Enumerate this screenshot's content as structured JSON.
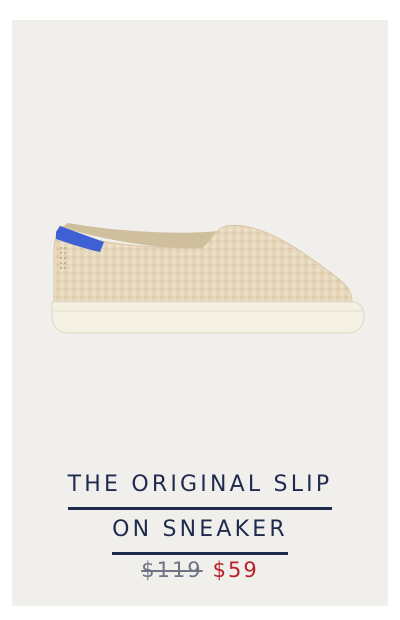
{
  "product": {
    "image_alt": "Cream boucle slip-on sneaker, side view",
    "title_line_1": "THE ORIGINAL SLIP",
    "title_line_2": "ON SNEAKER",
    "price_original": "$119",
    "price_sale": "$59"
  },
  "colors": {
    "background_card": "#f1efec",
    "title": "#1f2a4d",
    "sale_price": "#b6222a",
    "original_price": "#6f7485",
    "heel_tab": "#3f5fd4",
    "upper": "#e7d9bf",
    "sole": "#f4f0e2"
  }
}
